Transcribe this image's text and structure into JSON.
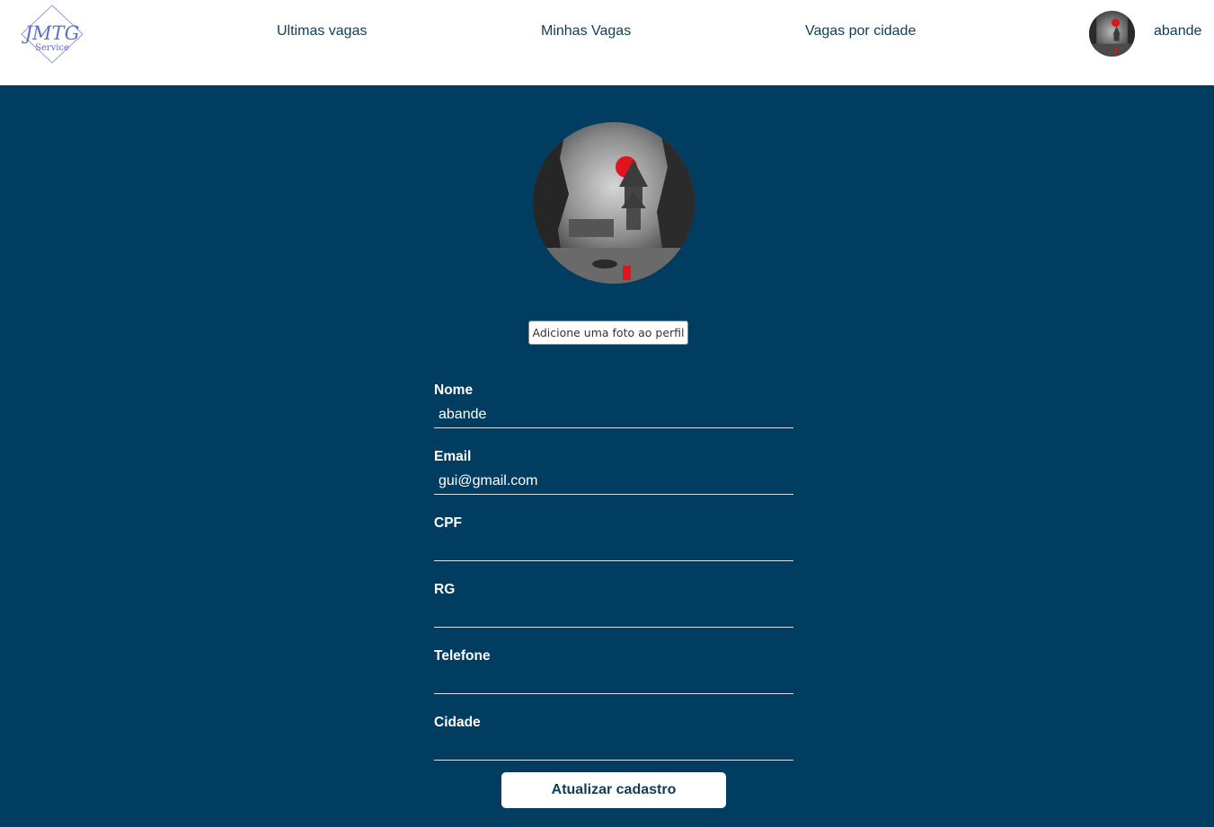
{
  "header": {
    "logo": {
      "main_text": "JMTG",
      "sub_text": "Service",
      "color": "#5a6fc8"
    },
    "nav": [
      {
        "label": "Ultimas vagas"
      },
      {
        "label": "Minhas Vagas"
      },
      {
        "label": "Vagas por cidade"
      }
    ],
    "user": {
      "name": "abande",
      "avatar_icon": "user-avatar-image"
    }
  },
  "profile": {
    "photo_icon": "profile-photo-image",
    "add_photo_label": "Adicione uma foto ao perfil"
  },
  "form": {
    "fields": [
      {
        "label": "Nome",
        "value": "abande"
      },
      {
        "label": "Email",
        "value": "gui@gmail.com"
      },
      {
        "label": "CPF",
        "value": ""
      },
      {
        "label": "RG",
        "value": ""
      },
      {
        "label": "Telefone",
        "value": ""
      },
      {
        "label": "Cidade",
        "value": ""
      }
    ],
    "submit_label": "Atualizar cadastro"
  },
  "colors": {
    "background": "#013d61",
    "header_bg": "#ffffff",
    "nav_text": "#0f3d57",
    "accent_red": "#e0141c"
  }
}
